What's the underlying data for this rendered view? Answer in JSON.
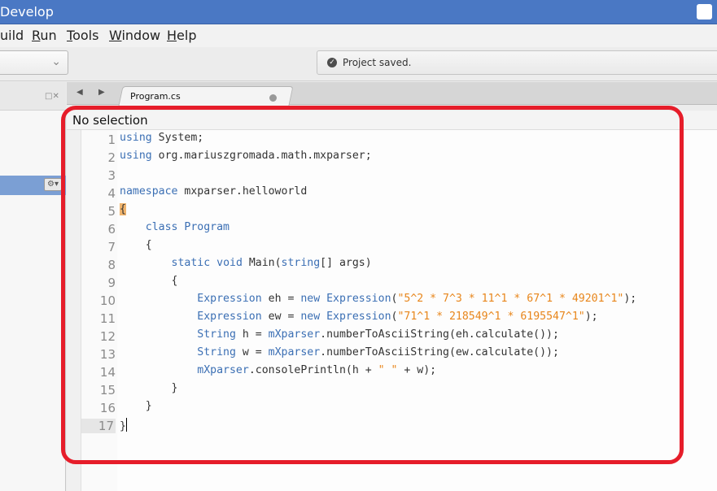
{
  "window": {
    "title": "Develop"
  },
  "menubar": {
    "items": [
      {
        "pre": "",
        "u": "",
        "post": "uild"
      },
      {
        "pre": "",
        "u": "R",
        "post": "un"
      },
      {
        "pre": "",
        "u": "T",
        "post": "ools"
      },
      {
        "pre": "",
        "u": "W",
        "post": "indow"
      },
      {
        "pre": "",
        "u": "H",
        "post": "elp"
      }
    ]
  },
  "toolbar": {
    "status_message": "Project saved."
  },
  "tab": {
    "label": "Program.cs"
  },
  "editor": {
    "selection_status": "No selection",
    "lines": [
      {
        "n": "1"
      },
      {
        "n": "2"
      },
      {
        "n": "3"
      },
      {
        "n": "4"
      },
      {
        "n": "5"
      },
      {
        "n": "6"
      },
      {
        "n": "7"
      },
      {
        "n": "8"
      },
      {
        "n": "9"
      },
      {
        "n": "10"
      },
      {
        "n": "11"
      },
      {
        "n": "12"
      },
      {
        "n": "13"
      },
      {
        "n": "14"
      },
      {
        "n": "15"
      },
      {
        "n": "16"
      },
      {
        "n": "17"
      }
    ],
    "current_line": "17",
    "code": {
      "l1": {
        "kw": "using",
        "rest": " System;"
      },
      "l2": {
        "kw": "using",
        "rest": " org.mariuszgromada.math.mxparser;"
      },
      "l4": {
        "kw": "namespace",
        "rest": " mxparser.helloworld"
      },
      "l5": {
        "brace": "{"
      },
      "l6": {
        "kw": "class",
        "ty": "Program"
      },
      "l7": {
        "brace": "{"
      },
      "l8": {
        "kw1": "static",
        "kw2": "void",
        "name": " Main(",
        "ty": "string",
        "rest": "[] args)"
      },
      "l9": {
        "brace": "{"
      },
      "l10": {
        "ty1": "Expression",
        "mid": " eh = ",
        "kw": "new",
        "ty2": "Expression",
        "open": "(",
        "str": "\"5^2 * 7^3 * 11^1 * 67^1 * 49201^1\"",
        "close": ");"
      },
      "l11": {
        "ty1": "Expression",
        "mid": " ew = ",
        "kw": "new",
        "ty2": "Expression",
        "open": "(",
        "str": "\"71^1 * 218549^1 * 6195547^1\"",
        "close": ");"
      },
      "l12": {
        "ty1": "String",
        "mid": " h = ",
        "ty2": "mXparser",
        "rest": ".numberToAsciiString(eh.calculate());"
      },
      "l13": {
        "ty1": "String",
        "mid": " w = ",
        "ty2": "mXparser",
        "rest": ".numberToAsciiString(ew.calculate());"
      },
      "l14": {
        "ty1": "mXparser",
        "rest": ".consolePrintln(h + ",
        "str": "\" \"",
        "close": " + w);"
      },
      "l15": {
        "brace": "}"
      },
      "l16": {
        "brace": "}"
      },
      "l17": {
        "brace": "}"
      }
    }
  },
  "colors": {
    "keyword": "#3b6fb4",
    "string": "#e8861b",
    "annotation": "#e61d2a",
    "titlebar": "#4a78c4"
  },
  "icons": {
    "check": "check-circle-icon",
    "chevron": "chevron-down-icon",
    "gear": "gear-icon"
  }
}
